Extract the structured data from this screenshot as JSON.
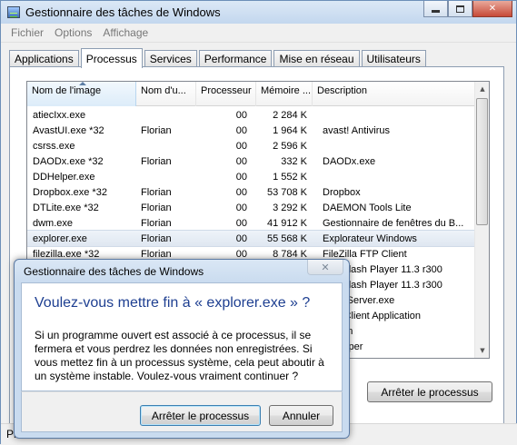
{
  "window": {
    "title": "Gestionnaire des tâches de Windows",
    "close_glyph": "✕"
  },
  "menu": [
    "Fichier",
    "Options",
    "Affichage"
  ],
  "tabs": [
    {
      "label": "Applications",
      "active": false
    },
    {
      "label": "Processus",
      "active": true
    },
    {
      "label": "Services",
      "active": false
    },
    {
      "label": "Performance",
      "active": false
    },
    {
      "label": "Mise en réseau",
      "active": false
    },
    {
      "label": "Utilisateurs",
      "active": false
    }
  ],
  "table": {
    "columns": [
      "Nom de l'image",
      "Nom d'u...",
      "Processeur",
      "Mémoire ...",
      "Description"
    ],
    "sorted_column": "Nom de l'image",
    "rows": [
      {
        "name": "atiecIxx.exe",
        "user": "",
        "cpu": "00",
        "mem": "2 284 K",
        "desc": ""
      },
      {
        "name": "AvastUI.exe *32",
        "user": "Florian",
        "cpu": "00",
        "mem": "1 964 K",
        "desc": "avast! Antivirus"
      },
      {
        "name": "csrss.exe",
        "user": "",
        "cpu": "00",
        "mem": "2 596 K",
        "desc": ""
      },
      {
        "name": "DAODx.exe *32",
        "user": "Florian",
        "cpu": "00",
        "mem": "332 K",
        "desc": "DAODx.exe"
      },
      {
        "name": "DDHelper.exe",
        "user": "",
        "cpu": "00",
        "mem": "1 552 K",
        "desc": ""
      },
      {
        "name": "Dropbox.exe *32",
        "user": "Florian",
        "cpu": "00",
        "mem": "53 708 K",
        "desc": "Dropbox"
      },
      {
        "name": "DTLite.exe *32",
        "user": "Florian",
        "cpu": "00",
        "mem": "3 292 K",
        "desc": "DAEMON Tools Lite"
      },
      {
        "name": "dwm.exe",
        "user": "Florian",
        "cpu": "00",
        "mem": "41 912 K",
        "desc": "Gestionnaire de fenêtres du B..."
      },
      {
        "name": "explorer.exe",
        "user": "Florian",
        "cpu": "00",
        "mem": "55 568 K",
        "desc": "Explorateur Windows",
        "selected": true
      },
      {
        "name": "filezilla.exe *32",
        "user": "Florian",
        "cpu": "00",
        "mem": "8 784 K",
        "desc": "FileZilla FTP Client"
      }
    ],
    "partial_rows": [
      "Flash Player 11.3 r300",
      "Flash Player 11.3 r300",
      "ostServer.exe",
      "hi Client Application",
      "mon",
      "Helper"
    ]
  },
  "end_process_button": "Arrêter le processus",
  "status_prefix": "Pr",
  "dialog": {
    "title": "Gestionnaire des tâches de Windows",
    "close_glyph": "✕",
    "heading": "Voulez-vous mettre fin à « explorer.exe » ?",
    "body": "Si un programme ouvert est associé à ce processus, il se fermera et vous perdrez les données non enregistrées. Si vous mettez fin à un processus système, cela peut aboutir à un système instable. Voulez-vous vraiment continuer ?",
    "confirm_label": "Arrêter le processus",
    "cancel_label": "Annuler"
  }
}
